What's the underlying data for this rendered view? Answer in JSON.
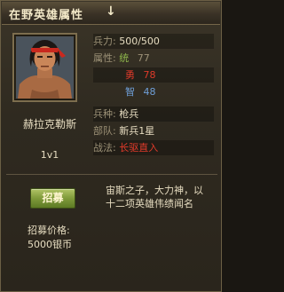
{
  "window": {
    "title": "在野英雄属性",
    "title_arrow": "↓"
  },
  "hero": {
    "name": "赫拉克勒斯",
    "level": "1v1",
    "stats": {
      "troops_label": "兵力:",
      "troops_value": "500/500",
      "attr_label": "属性:",
      "tong_label": "统",
      "tong_value": "77",
      "yong_label": "勇",
      "yong_value": "78",
      "zhi_label": "智",
      "zhi_value": "48",
      "arm_label": "兵种:",
      "arm_value": "枪兵",
      "team_label": "部队:",
      "team_value": "新兵1星",
      "tactic_label": "战法:",
      "tactic_value": "长驱直入"
    },
    "description": "宙斯之子，大力神，以十二项英雄伟绩闻名"
  },
  "recruit": {
    "button_label": "招募",
    "price_label": "招募价格:",
    "price_value": "5000银币"
  },
  "colors": {
    "accent_red": "#e03a2a",
    "accent_green": "#8fb84c",
    "accent_blue": "#6f9fd8"
  }
}
